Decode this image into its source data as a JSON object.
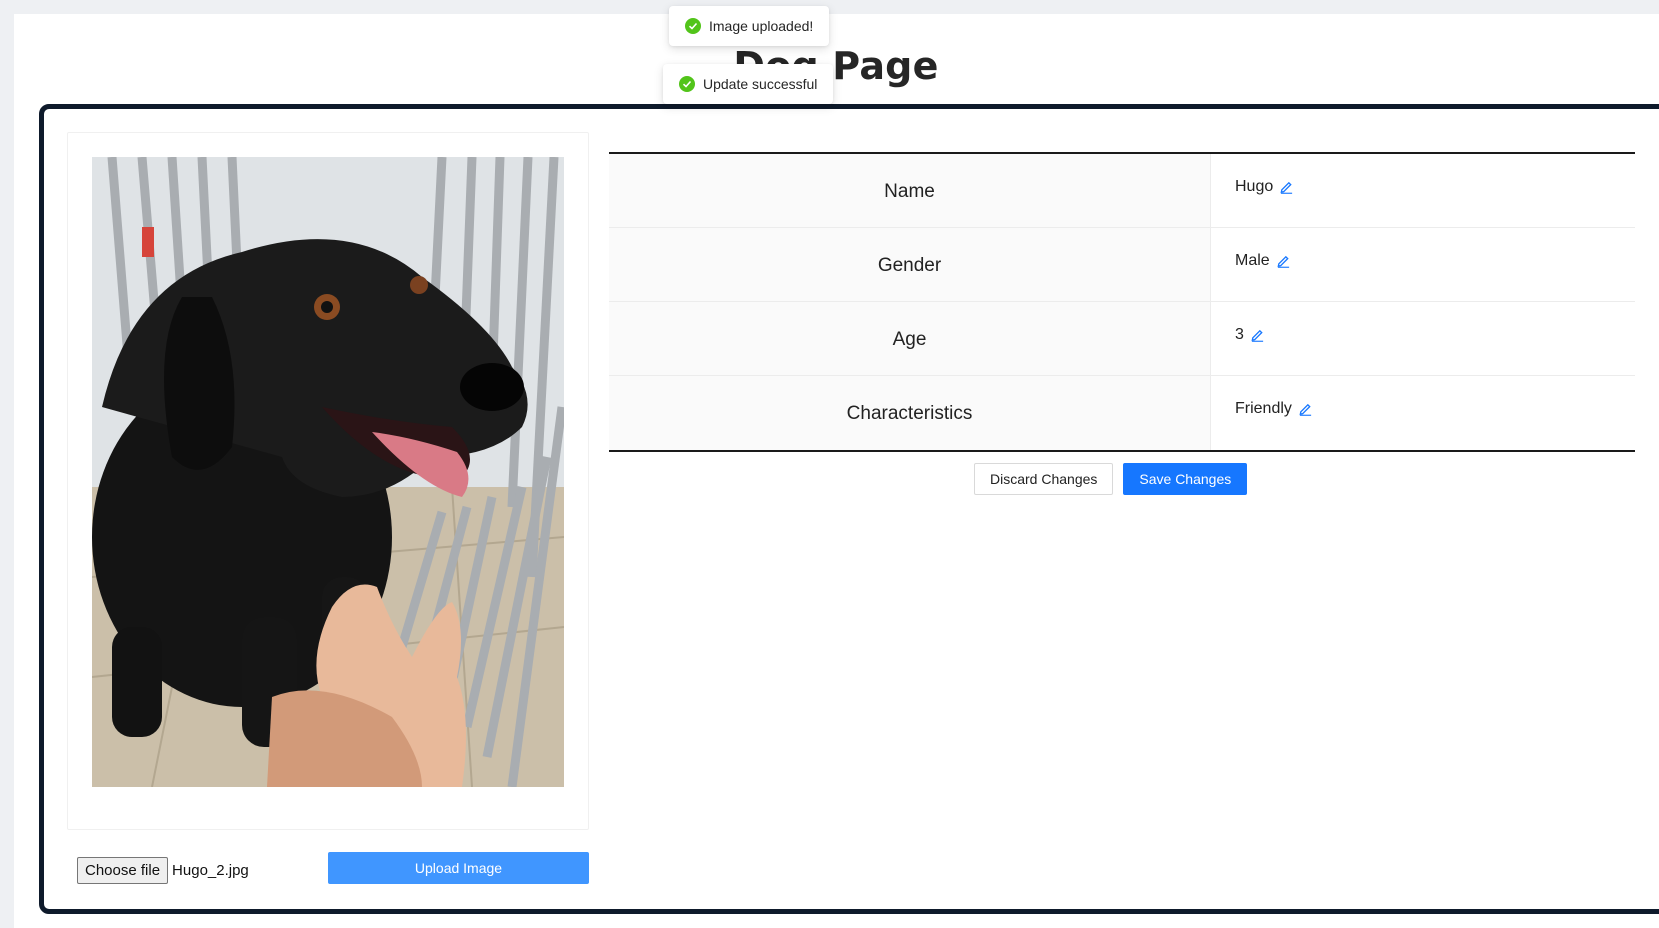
{
  "page": {
    "title": "Dog Page"
  },
  "toasts": [
    {
      "message": "Image uploaded!",
      "icon": "success-check-icon",
      "color": "#52c41a"
    },
    {
      "message": "Update successful",
      "icon": "success-check-icon",
      "color": "#52c41a"
    }
  ],
  "image_panel": {
    "photo_alt": "Hugo",
    "choose_file_label": "Choose file",
    "selected_file": "Hugo_2.jpg",
    "upload_label": "Upload Image"
  },
  "details": {
    "rows": [
      {
        "label": "Name",
        "value": "Hugo",
        "edit_icon": "edit-pencil-icon"
      },
      {
        "label": "Gender",
        "value": "Male",
        "edit_icon": "edit-pencil-icon"
      },
      {
        "label": "Age",
        "value": "3",
        "edit_icon": "edit-pencil-icon"
      },
      {
        "label": "Characteristics",
        "value": "Friendly",
        "edit_icon": "edit-pencil-icon"
      }
    ]
  },
  "actions": {
    "discard_label": "Discard Changes",
    "save_label": "Save Changes"
  },
  "colors": {
    "primary": "#1677ff",
    "upload": "#4096ff",
    "card_border": "#0e1a2b",
    "success": "#52c41a"
  }
}
